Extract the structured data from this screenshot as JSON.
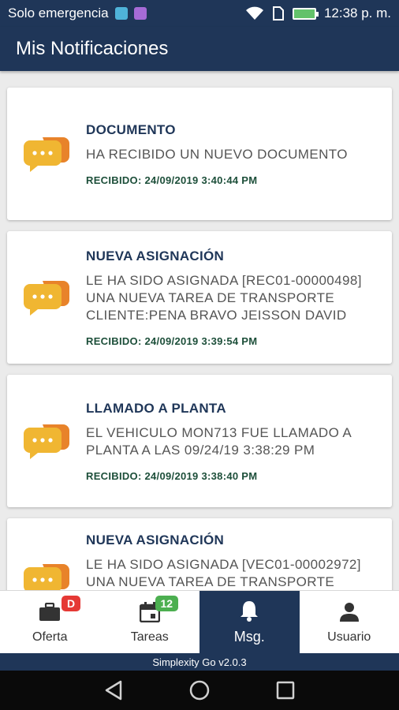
{
  "status_bar": {
    "carrier": "Solo emergencia",
    "time": "12:38 p. m."
  },
  "app_bar": {
    "title": "Mis Notificaciones"
  },
  "notifications": [
    {
      "title": "DOCUMENTO",
      "message": "HA RECIBIDO UN NUEVO DOCUMENTO",
      "received": "RECIBIDO: 24/09/2019 3:40:44 PM"
    },
    {
      "title": "NUEVA ASIGNACIÓN",
      "message": "LE HA SIDO ASIGNADA [REC01-00000498] UNA NUEVA TAREA DE TRANSPORTE CLIENTE:PENA BRAVO JEISSON DAVID",
      "received": "RECIBIDO: 24/09/2019 3:39:54 PM"
    },
    {
      "title": "LLAMADO A PLANTA",
      "message": "EL VEHICULO MON713 FUE LLAMADO A PLANTA A LAS 09/24/19 3:38:29 PM",
      "received": "RECIBIDO: 24/09/2019 3:38:40 PM"
    },
    {
      "title": "NUEVA ASIGNACIÓN",
      "message": "LE HA SIDO ASIGNADA [VEC01-00002972] UNA NUEVA TAREA DE TRANSPORTE",
      "received": ""
    }
  ],
  "bottom_nav": {
    "oferta": {
      "label": "Oferta",
      "badge": "D"
    },
    "tareas": {
      "label": "Tareas",
      "badge": "12"
    },
    "msg": {
      "label": "Msg."
    },
    "usuario": {
      "label": "Usuario"
    }
  },
  "version": "Simplexity Go v2.0.3",
  "colors": {
    "primary": "#1f3658",
    "icon_orange": "#e8a52b",
    "received_green": "#1d4f3a",
    "badge_red": "#e53935",
    "badge_green": "#4caf50"
  }
}
